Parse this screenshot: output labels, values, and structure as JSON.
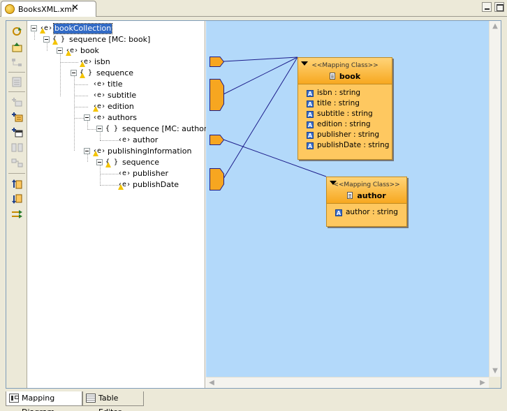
{
  "editor": {
    "tab_title": "BooksXML.xmi",
    "close_glyph": "✕"
  },
  "tree": {
    "nodes": [
      {
        "label": "bookCollection",
        "kind": "element",
        "warn": true,
        "depth": 0,
        "selected": true
      },
      {
        "label": "sequence [MC: book]",
        "kind": "sequence",
        "warn": true,
        "depth": 1
      },
      {
        "label": "book",
        "kind": "element",
        "warn": true,
        "depth": 2
      },
      {
        "label": "isbn",
        "kind": "element",
        "warn": true,
        "depth": 3
      },
      {
        "label": "sequence",
        "kind": "sequence",
        "warn": true,
        "depth": 3
      },
      {
        "label": "title",
        "kind": "element",
        "warn": false,
        "depth": 4
      },
      {
        "label": "subtitle",
        "kind": "element",
        "warn": false,
        "depth": 4
      },
      {
        "label": "edition",
        "kind": "element",
        "warn": true,
        "depth": 4
      },
      {
        "label": "authors",
        "kind": "element",
        "warn": false,
        "depth": 4
      },
      {
        "label": "sequence [MC: author]",
        "kind": "sequence",
        "warn": false,
        "depth": 5
      },
      {
        "label": "author",
        "kind": "element",
        "warn": false,
        "depth": 6
      },
      {
        "label": "publishingInformation",
        "kind": "element",
        "warn": true,
        "depth": 4
      },
      {
        "label": "sequence",
        "kind": "sequence",
        "warn": true,
        "depth": 5
      },
      {
        "label": "publisher",
        "kind": "element",
        "warn": false,
        "depth": 6
      },
      {
        "label": "publishDate",
        "kind": "element",
        "warn": true,
        "depth": 6
      }
    ]
  },
  "diagram": {
    "classes": [
      {
        "id": "book",
        "stereotype": "<<Mapping Class>>",
        "name": "book",
        "attributes": [
          "isbn : string",
          "title : string",
          "subtitle : string",
          "edition : string",
          "publisher : string",
          "publishDate : string"
        ]
      },
      {
        "id": "author",
        "stereotype": "<<Mapping Class>>",
        "name": "author",
        "attributes": [
          "author : string"
        ]
      }
    ],
    "colors": {
      "canvas": "#b3d9fa",
      "class_fill": "#fec860",
      "port_fill": "#f7a620",
      "wire": "#1c1c8a"
    }
  },
  "bottom_tabs": [
    {
      "label": "Mapping Diagram",
      "active": true
    },
    {
      "label": "Table Editor",
      "active": false
    }
  ]
}
